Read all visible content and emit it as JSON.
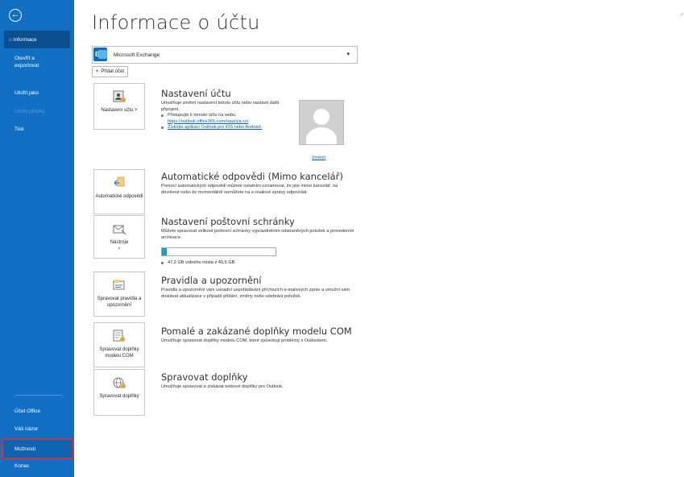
{
  "sidebar": {
    "items": [
      {
        "label": "Informace"
      },
      {
        "label": "Otevřít a exportovat"
      },
      {
        "label": "Uložit jako"
      },
      {
        "label": "Uložit přílohy"
      },
      {
        "label": "Tisk"
      },
      {
        "label": "Účet Office"
      },
      {
        "label": "Váš názor"
      },
      {
        "label": "Možnosti"
      },
      {
        "label": "Konec"
      }
    ]
  },
  "page": {
    "title": "Informace o účtu"
  },
  "account": {
    "name": "Microsoft Exchange",
    "add_label": "Přidat účet"
  },
  "sections": [
    {
      "button": "Nastavení účtu ˅",
      "title": "Nastavení účtu",
      "desc": "Umožňuje změnit nastavení tohoto účtu nebo nastavit další připojení.",
      "bullet1": "Přistupujte k tomuto účtu na webu.",
      "link1": "https://outlook.office365.com/owa/ica.cz/",
      "link2": "Získejte aplikaci Outlook pro iOS nebo Android.",
      "photo_link": "Změnit"
    },
    {
      "button": "Automatické odpovědi",
      "title": "Automatické odpovědi (Mimo kancelář)",
      "desc": "Pomocí automatických odpovědí můžete ostatním oznamovat, že jste mimo kancelář, na dovolené nebo že momentálně nemůžete na e-mailové zprávy odpovídat."
    },
    {
      "button": "Nástroje",
      "title": "Nastavení poštovní schránky",
      "desc": "Můžete spravovat velikost poštovní schránky vyprázdněním odstraněných položek a provedením archivace.",
      "storage_label": "47,2 GB volného místa z 49,5 GB",
      "usage_fraction": 0.046
    },
    {
      "button": "Spravovat pravidla a upozornění",
      "title": "Pravidla a upozornění",
      "desc": "Pravidla a upozornění vám usnadní uspořádávání příchozích e-mailových zpráv a umožní vám dostávat aktualizace v případě přidání, změny nebo odebrání položek."
    },
    {
      "button": "Spravovat doplňky modelu COM",
      "title": "Pomalé a zakázané doplňky modelu COM",
      "desc": "Umožňuje spravovat doplňky modelu COM, které způsobují problémy s Outlookem."
    },
    {
      "button": "Spravovat doplňky",
      "title": "Spravovat doplňky",
      "desc": "Umožňuje spravovat a získávat webové doplňky pro Outlook."
    }
  ],
  "colors": {
    "sidebar": "#1170c4",
    "highlight": "#d13438",
    "link": "#0563c1"
  }
}
